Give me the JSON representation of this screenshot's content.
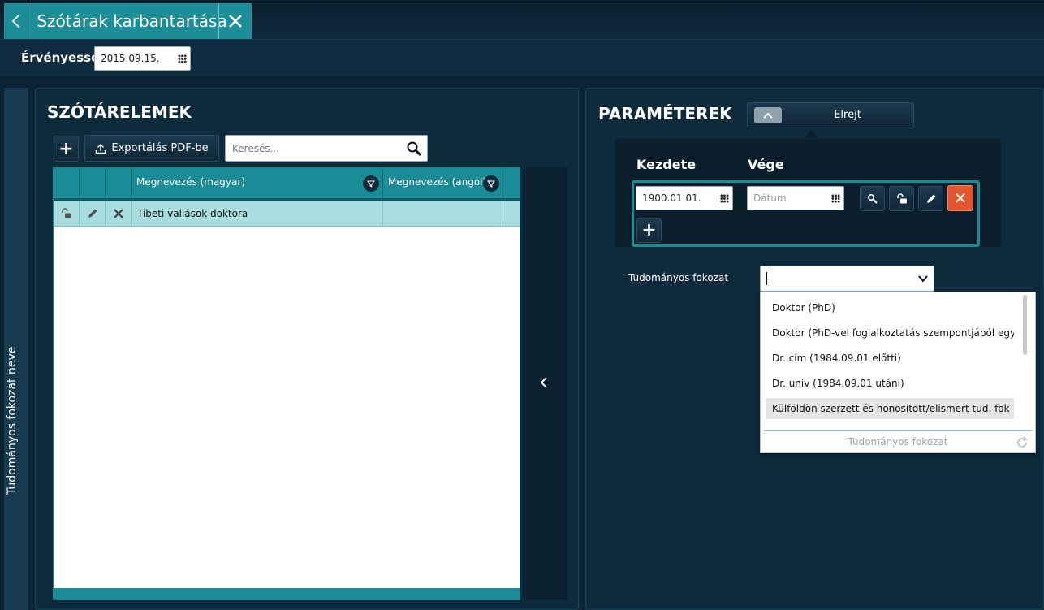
{
  "header": {
    "back_icon": "chevron-left-icon",
    "title": "Szótárak karbantartása",
    "close_icon": "close-icon"
  },
  "validity": {
    "label": "Érvényesség",
    "date": "2015.09.15."
  },
  "side_panel": {
    "label": "Tudományos fokozat neve"
  },
  "dictionary": {
    "title": "SZÓTÁRELEMEK",
    "add_label": "+",
    "export_label": "Exportálás PDF-be",
    "search_placeholder": "Keresés...",
    "columns": [
      "Megnevezés (magyar)",
      "Megnevezés (angol)"
    ],
    "rows": [
      {
        "name_hu": "Tibeti vallások doktora",
        "name_en": ""
      }
    ],
    "collapse_icon": "chevron-left-icon"
  },
  "parameters": {
    "title": "PARAMÉTEREK",
    "hide_label": "Elrejt",
    "start_label": "Kezdete",
    "end_label": "Vége",
    "start_date": "1900.01.01.",
    "end_placeholder": "Dátum",
    "delete_label": "✕",
    "add_label": "+",
    "degree_label": "Tudományos fokozat",
    "degree_value": "",
    "dropdown_options": [
      "Doktor (PhD)",
      "Doktor (PhD-vel foglalkoztatás szempontjából egyen",
      "Dr. cím (1984.09.01 előtti)",
      "Dr. univ (1984.09.01 utáni)",
      "Külföldön szerzett és honosított/elismert tud. fok"
    ],
    "highlighted_option": 4,
    "dropdown_footer": "Tudományos fokozat"
  },
  "colors": {
    "accent": "#1a8c97",
    "background": "#0b2333",
    "panel": "#0e2a3d",
    "delete": "#e4572e"
  }
}
